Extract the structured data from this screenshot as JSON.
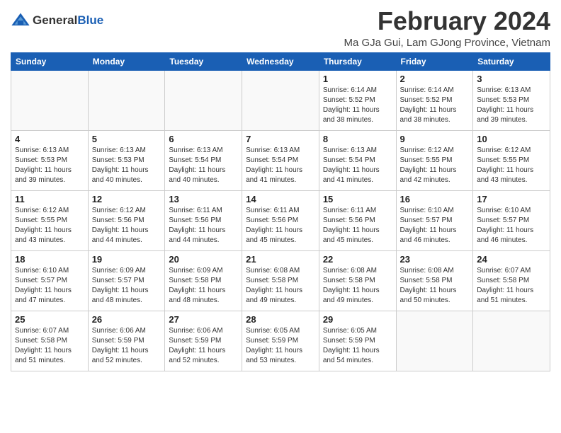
{
  "logo": {
    "general": "General",
    "blue": "Blue"
  },
  "header": {
    "month_year": "February 2024",
    "location": "Ma GJa Gui, Lam GJong Province, Vietnam"
  },
  "weekdays": [
    "Sunday",
    "Monday",
    "Tuesday",
    "Wednesday",
    "Thursday",
    "Friday",
    "Saturday"
  ],
  "weeks": [
    [
      {
        "day": "",
        "info": ""
      },
      {
        "day": "",
        "info": ""
      },
      {
        "day": "",
        "info": ""
      },
      {
        "day": "",
        "info": ""
      },
      {
        "day": "1",
        "info": "Sunrise: 6:14 AM\nSunset: 5:52 PM\nDaylight: 11 hours and 38 minutes."
      },
      {
        "day": "2",
        "info": "Sunrise: 6:14 AM\nSunset: 5:52 PM\nDaylight: 11 hours and 38 minutes."
      },
      {
        "day": "3",
        "info": "Sunrise: 6:13 AM\nSunset: 5:53 PM\nDaylight: 11 hours and 39 minutes."
      }
    ],
    [
      {
        "day": "4",
        "info": "Sunrise: 6:13 AM\nSunset: 5:53 PM\nDaylight: 11 hours and 39 minutes."
      },
      {
        "day": "5",
        "info": "Sunrise: 6:13 AM\nSunset: 5:53 PM\nDaylight: 11 hours and 40 minutes."
      },
      {
        "day": "6",
        "info": "Sunrise: 6:13 AM\nSunset: 5:54 PM\nDaylight: 11 hours and 40 minutes."
      },
      {
        "day": "7",
        "info": "Sunrise: 6:13 AM\nSunset: 5:54 PM\nDaylight: 11 hours and 41 minutes."
      },
      {
        "day": "8",
        "info": "Sunrise: 6:13 AM\nSunset: 5:54 PM\nDaylight: 11 hours and 41 minutes."
      },
      {
        "day": "9",
        "info": "Sunrise: 6:12 AM\nSunset: 5:55 PM\nDaylight: 11 hours and 42 minutes."
      },
      {
        "day": "10",
        "info": "Sunrise: 6:12 AM\nSunset: 5:55 PM\nDaylight: 11 hours and 43 minutes."
      }
    ],
    [
      {
        "day": "11",
        "info": "Sunrise: 6:12 AM\nSunset: 5:55 PM\nDaylight: 11 hours and 43 minutes."
      },
      {
        "day": "12",
        "info": "Sunrise: 6:12 AM\nSunset: 5:56 PM\nDaylight: 11 hours and 44 minutes."
      },
      {
        "day": "13",
        "info": "Sunrise: 6:11 AM\nSunset: 5:56 PM\nDaylight: 11 hours and 44 minutes."
      },
      {
        "day": "14",
        "info": "Sunrise: 6:11 AM\nSunset: 5:56 PM\nDaylight: 11 hours and 45 minutes."
      },
      {
        "day": "15",
        "info": "Sunrise: 6:11 AM\nSunset: 5:56 PM\nDaylight: 11 hours and 45 minutes."
      },
      {
        "day": "16",
        "info": "Sunrise: 6:10 AM\nSunset: 5:57 PM\nDaylight: 11 hours and 46 minutes."
      },
      {
        "day": "17",
        "info": "Sunrise: 6:10 AM\nSunset: 5:57 PM\nDaylight: 11 hours and 46 minutes."
      }
    ],
    [
      {
        "day": "18",
        "info": "Sunrise: 6:10 AM\nSunset: 5:57 PM\nDaylight: 11 hours and 47 minutes."
      },
      {
        "day": "19",
        "info": "Sunrise: 6:09 AM\nSunset: 5:57 PM\nDaylight: 11 hours and 48 minutes."
      },
      {
        "day": "20",
        "info": "Sunrise: 6:09 AM\nSunset: 5:58 PM\nDaylight: 11 hours and 48 minutes."
      },
      {
        "day": "21",
        "info": "Sunrise: 6:08 AM\nSunset: 5:58 PM\nDaylight: 11 hours and 49 minutes."
      },
      {
        "day": "22",
        "info": "Sunrise: 6:08 AM\nSunset: 5:58 PM\nDaylight: 11 hours and 49 minutes."
      },
      {
        "day": "23",
        "info": "Sunrise: 6:08 AM\nSunset: 5:58 PM\nDaylight: 11 hours and 50 minutes."
      },
      {
        "day": "24",
        "info": "Sunrise: 6:07 AM\nSunset: 5:58 PM\nDaylight: 11 hours and 51 minutes."
      }
    ],
    [
      {
        "day": "25",
        "info": "Sunrise: 6:07 AM\nSunset: 5:58 PM\nDaylight: 11 hours and 51 minutes."
      },
      {
        "day": "26",
        "info": "Sunrise: 6:06 AM\nSunset: 5:59 PM\nDaylight: 11 hours and 52 minutes."
      },
      {
        "day": "27",
        "info": "Sunrise: 6:06 AM\nSunset: 5:59 PM\nDaylight: 11 hours and 52 minutes."
      },
      {
        "day": "28",
        "info": "Sunrise: 6:05 AM\nSunset: 5:59 PM\nDaylight: 11 hours and 53 minutes."
      },
      {
        "day": "29",
        "info": "Sunrise: 6:05 AM\nSunset: 5:59 PM\nDaylight: 11 hours and 54 minutes."
      },
      {
        "day": "",
        "info": ""
      },
      {
        "day": "",
        "info": ""
      }
    ]
  ]
}
